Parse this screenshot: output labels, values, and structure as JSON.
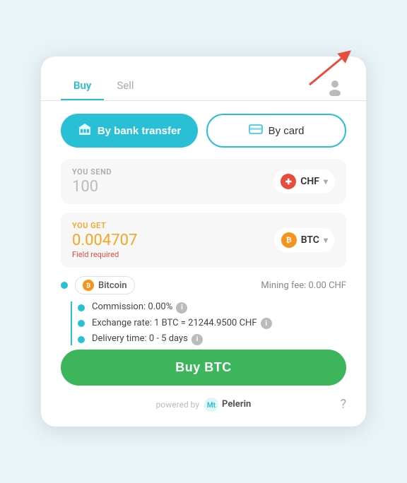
{
  "tabs": [
    {
      "label": "Buy",
      "active": true
    },
    {
      "label": "Sell",
      "active": false
    }
  ],
  "payment": {
    "bank_label": "By bank transfer",
    "card_label": "By card"
  },
  "send_field": {
    "label": "YOU SEND",
    "value": "100",
    "currency": "CHF"
  },
  "get_field": {
    "label": "YOU GET",
    "value": "0.004707",
    "currency": "BTC",
    "error": "Field required"
  },
  "bitcoin_row": {
    "name": "Bitcoin",
    "mining_fee": "Mining fee: 0.00 CHF"
  },
  "details": [
    {
      "label": "Commission: 0.00%",
      "has_info": true
    },
    {
      "label": "Exchange rate: 1 BTC = 21244.9500 CHF",
      "has_info": true
    },
    {
      "label": "Delivery time: 0 - 5 days",
      "has_info": true
    }
  ],
  "buy_button": "Buy BTC",
  "footer": {
    "powered_by": "powered by",
    "brand": "Mt\nPelerin"
  }
}
